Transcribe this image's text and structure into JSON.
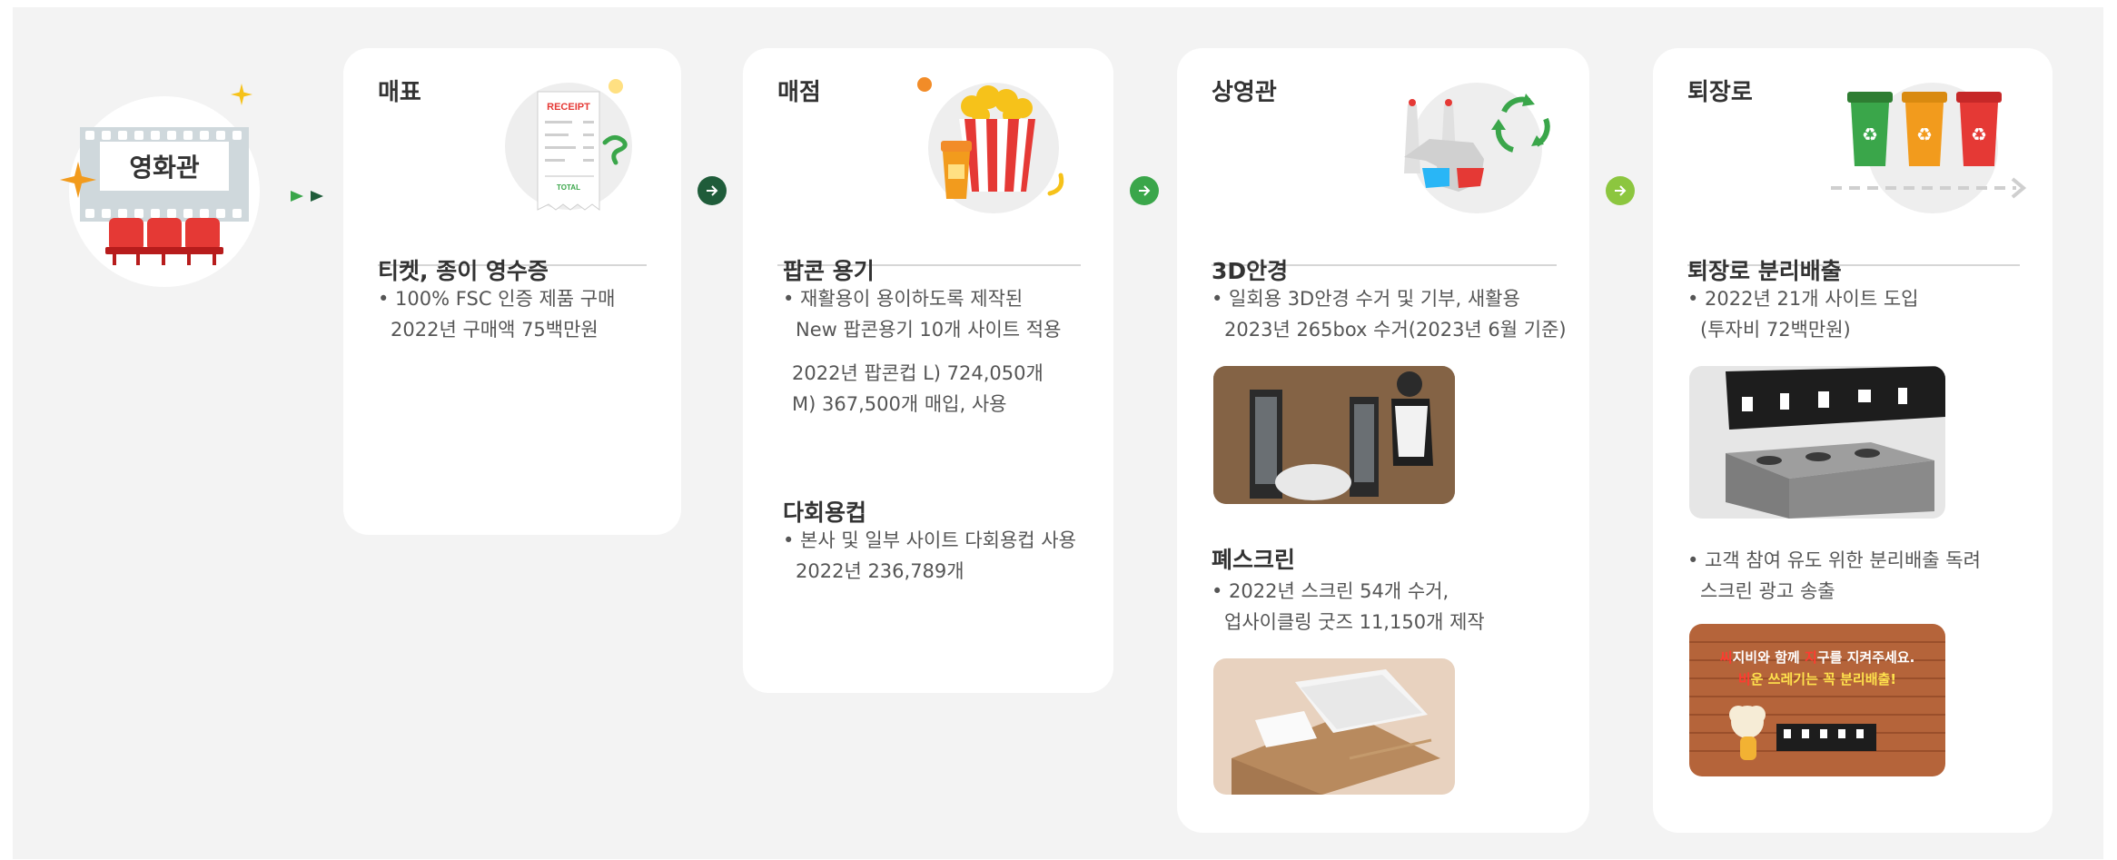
{
  "start": {
    "label": "영화관"
  },
  "cards": [
    {
      "title": "매표",
      "sections": [
        {
          "title": "티켓, 종이 영수증",
          "lines": [
            "• 100% FSC 인증 제품 구매",
            "2022년 구매액 75백만원"
          ]
        }
      ],
      "receipt": {
        "title": "RECEIPT",
        "total": "TOTAL"
      }
    },
    {
      "title": "매점",
      "sections": [
        {
          "title": "팝콘 용기",
          "lines": [
            "• 재활용이 용이하도록 제작된",
            "New 팝콘용기 10개 사이트 적용",
            "2022년 팝콘컵 L) 724,050개",
            "M) 367,500개 매입, 사용"
          ]
        },
        {
          "title": "다회용컵",
          "lines": [
            "• 본사 및 일부 사이트 다회용컵 사용",
            "2022년 236,789개"
          ]
        }
      ]
    },
    {
      "title": "상영관",
      "sections": [
        {
          "title": "3D안경",
          "lines": [
            "• 일회용 3D안경 수거 및 기부, 새활용",
            "2023년 265box 수거(2023년 6월 기준)"
          ]
        },
        {
          "title": "폐스크린",
          "lines": [
            "• 2022년 스크린 54개 수거,",
            "업사이클링 굿즈 11,150개 제작"
          ]
        }
      ]
    },
    {
      "title": "퇴장로",
      "sections": [
        {
          "title": "퇴장로 분리배출",
          "lines": [
            "• 2022년 21개 사이트 도입",
            "(투자비 72백만원)",
            "• 고객 참여 유도 위한 분리배출 독려",
            "스크린 광고 송출"
          ]
        }
      ],
      "ad": {
        "line1a": "씨",
        "line1b": "지비와 함께 ",
        "line1c": "지",
        "line1d": "구를 지켜주세요.",
        "line2a": "비",
        "line2b": "운 쓰레기는 꼭 분리배출!"
      }
    }
  ],
  "colors": {
    "step_arrow_1": "#1f5c3a",
    "step_arrow_2": "#3aa64a",
    "step_arrow_3": "#8cc63f",
    "popcorn_red": "#e53935",
    "bin_green": "#3aa64a",
    "bin_orange": "#f29b1d",
    "bin_red": "#e53935"
  }
}
